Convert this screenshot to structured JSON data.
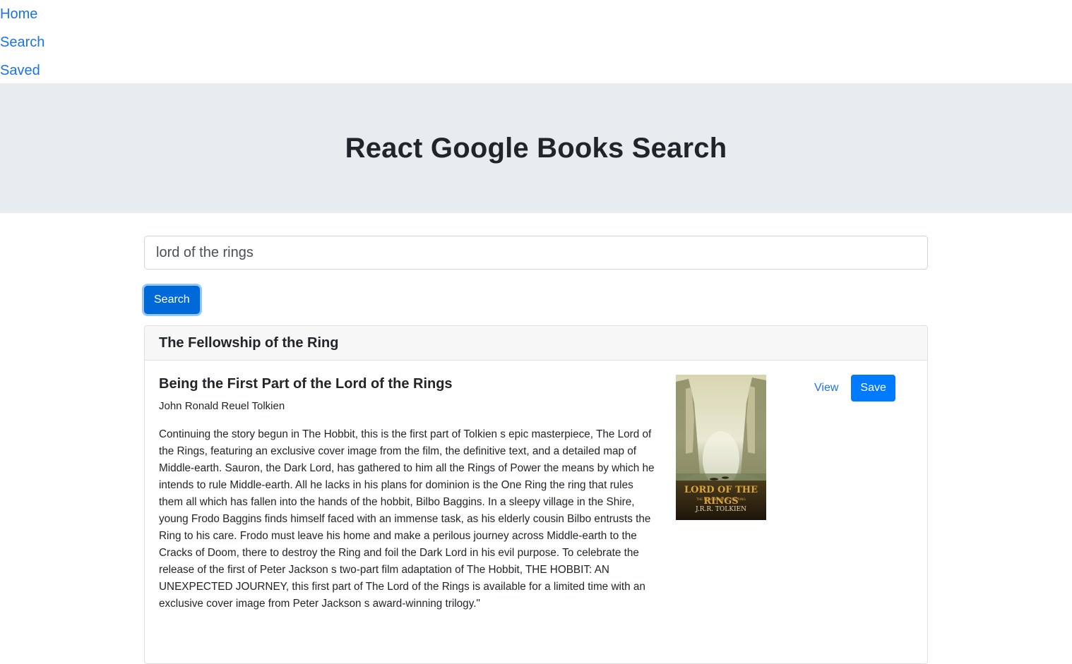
{
  "nav": {
    "items": [
      {
        "label": "Home"
      },
      {
        "label": "Search"
      },
      {
        "label": "Saved"
      }
    ]
  },
  "header": {
    "title": "React Google Books Search"
  },
  "search": {
    "value": "lord of the rings",
    "button_label": "Search"
  },
  "results": [
    {
      "title": "The Fellowship of the Ring",
      "subtitle": "Being the First Part of the Lord of the Rings",
      "author": "John Ronald Reuel Tolkien",
      "description": "Continuing the story begun in The Hobbit, this is the first part of Tolkien s epic masterpiece, The Lord of the Rings, featuring an exclusive cover image from the film, the definitive text, and a detailed map of Middle-earth. Sauron, the Dark Lord, has gathered to him all the Rings of Power the means by which he intends to rule Middle-earth. All he lacks in his plans for dominion is the One Ring the ring that rules them all which has fallen into the hands of the hobbit, Bilbo Baggins. In a sleepy village in the Shire, young Frodo Baggins finds himself faced with an immense task, as his elderly cousin Bilbo entrusts the Ring to his care. Frodo must leave his home and make a perilous journey across Middle-earth to the Cracks of Doom, there to destroy the Ring and foil the Dark Lord in his evil purpose. To celebrate the release of the first of Peter Jackson s two-part film adaptation of The Hobbit, THE HOBBIT: AN UNEXPECTED JOURNEY, this first part of The Lord of the Rings is available for a limited time with an exclusive cover image from Peter Jackson s award-winning trilogy.\"",
      "cover": {
        "title_art": "LORD OF THE RINGS",
        "subtitle_art": "THE FELLOWSHIP OF THE RING",
        "author_art": "J.R.R. TOLKIEN"
      },
      "view_label": "View",
      "save_label": "Save"
    }
  ],
  "colors": {
    "link": "#1a73e8",
    "primary": "#007bff",
    "jumbotron_bg": "#e9ecef"
  }
}
